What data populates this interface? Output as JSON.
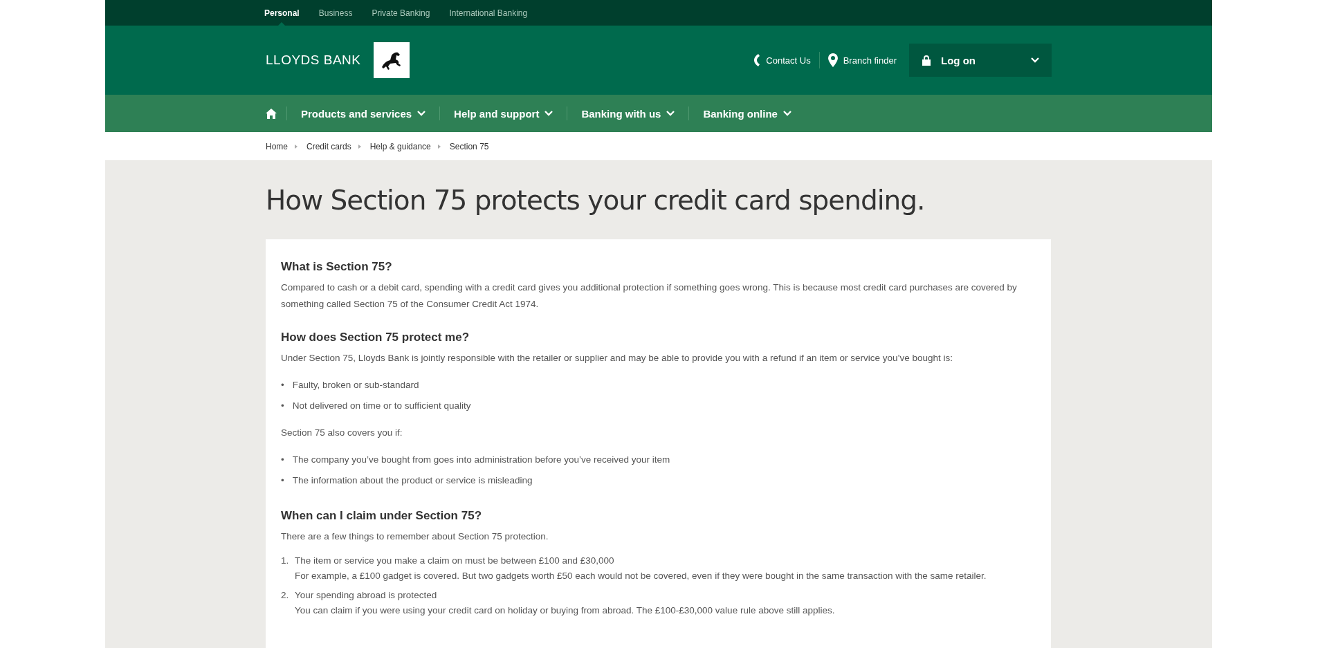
{
  "top_tabs": [
    {
      "label": "Personal",
      "selected": true
    },
    {
      "label": "Business",
      "selected": false
    },
    {
      "label": "Private Banking",
      "selected": false
    },
    {
      "label": "International Banking",
      "selected": false
    }
  ],
  "header": {
    "brand": "LLOYDS BANK",
    "contact": "Contact Us",
    "branch": "Branch finder",
    "login": "Log on"
  },
  "nav": [
    "Products and services",
    "Help and support",
    "Banking with us",
    "Banking online"
  ],
  "breadcrumb": [
    "Home",
    "Credit cards",
    "Help & guidance",
    "Section 75"
  ],
  "title": "How Section 75 protects your credit card spending.",
  "sections": [
    {
      "heading": "What is Section 75?",
      "blocks": [
        {
          "kind": "para",
          "text": "Compared to cash or a debit card, spending with a credit card gives you additional protection if something goes wrong. This is because most credit card purchases are covered by something called Section 75 of the Consumer Credit Act 1974."
        }
      ]
    },
    {
      "heading": "How does Section 75 protect me?",
      "blocks": [
        {
          "kind": "para",
          "text": "Under Section 75, Lloyds Bank  is jointly responsible with the retailer or supplier and may be able to provide you with a refund if an item or service you’ve bought is:"
        },
        {
          "kind": "bullets",
          "items": [
            {
              "marker": "•",
              "text": "Faulty, broken or sub-standard"
            },
            {
              "marker": "•",
              "text": "Not delivered on time or to sufficient quality"
            }
          ]
        },
        {
          "kind": "para",
          "text": "Section 75 also covers you if:"
        },
        {
          "kind": "bullets",
          "items": [
            {
              "marker": "•",
              "text": "The company you’ve bought from goes into administration before you’ve received your item"
            },
            {
              "marker": "•",
              "text": "The information about the product or service is misleading"
            }
          ]
        }
      ]
    },
    {
      "heading": "When can I claim under Section 75?",
      "blocks": [
        {
          "kind": "para",
          "text": "There are a few things to remember about Section 75 protection."
        },
        {
          "kind": "numbered",
          "items": [
            {
              "number": "1.",
              "title": "The item or service you make a claim on must be between £100 and £30,000",
              "detail": "For example, a £100 gadget is covered. But two gadgets worth £50 each would not be covered, even if they were bought in the same transaction with the same retailer."
            },
            {
              "number": "2.",
              "title": "Your spending abroad is protected",
              "detail": "You can claim if you were using your credit card on holiday or buying from abroad. The £100-£30,000 value rule above still applies."
            }
          ]
        }
      ]
    }
  ]
}
